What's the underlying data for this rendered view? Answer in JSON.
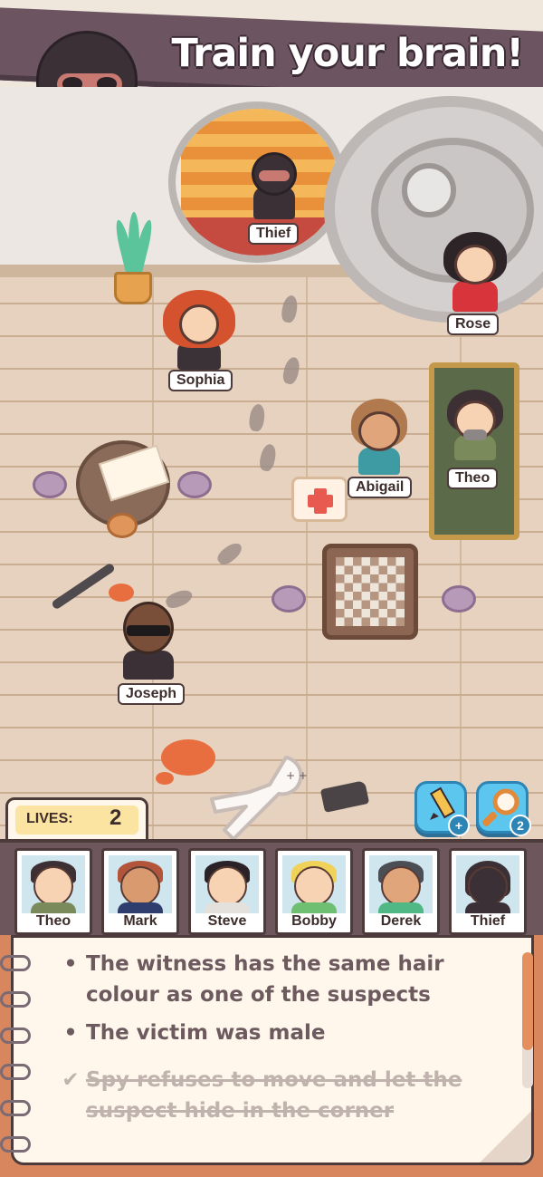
{
  "banner": {
    "title": "Train your brain!"
  },
  "scene": {
    "characters": {
      "thief": "Thief",
      "rose": "Rose",
      "sophia": "Sophia",
      "abigail": "Abigail",
      "theo": "Theo",
      "joseph": "Joseph"
    }
  },
  "tools": {
    "hint_count": "2"
  },
  "lives": {
    "label": "LIVES:",
    "value": "2"
  },
  "suspects": [
    {
      "name": "Theo"
    },
    {
      "name": "Mark"
    },
    {
      "name": "Steve"
    },
    {
      "name": "Bobby"
    },
    {
      "name": "Derek"
    },
    {
      "name": "Thief"
    }
  ],
  "clues": [
    {
      "mark": "•",
      "text": "The witness has the same hair colour as one of the suspects",
      "done": false
    },
    {
      "mark": "•",
      "text": "The victim was male",
      "done": false
    },
    {
      "mark": "✔",
      "text": "Spy refuses to move and let the suspect hide in the corner",
      "done": true
    }
  ],
  "colors": {
    "banner": "#6c5560",
    "floor": "#e6d2bf",
    "accent_blue": "#5cc6ef",
    "notebook_cover": "#d7865e"
  }
}
